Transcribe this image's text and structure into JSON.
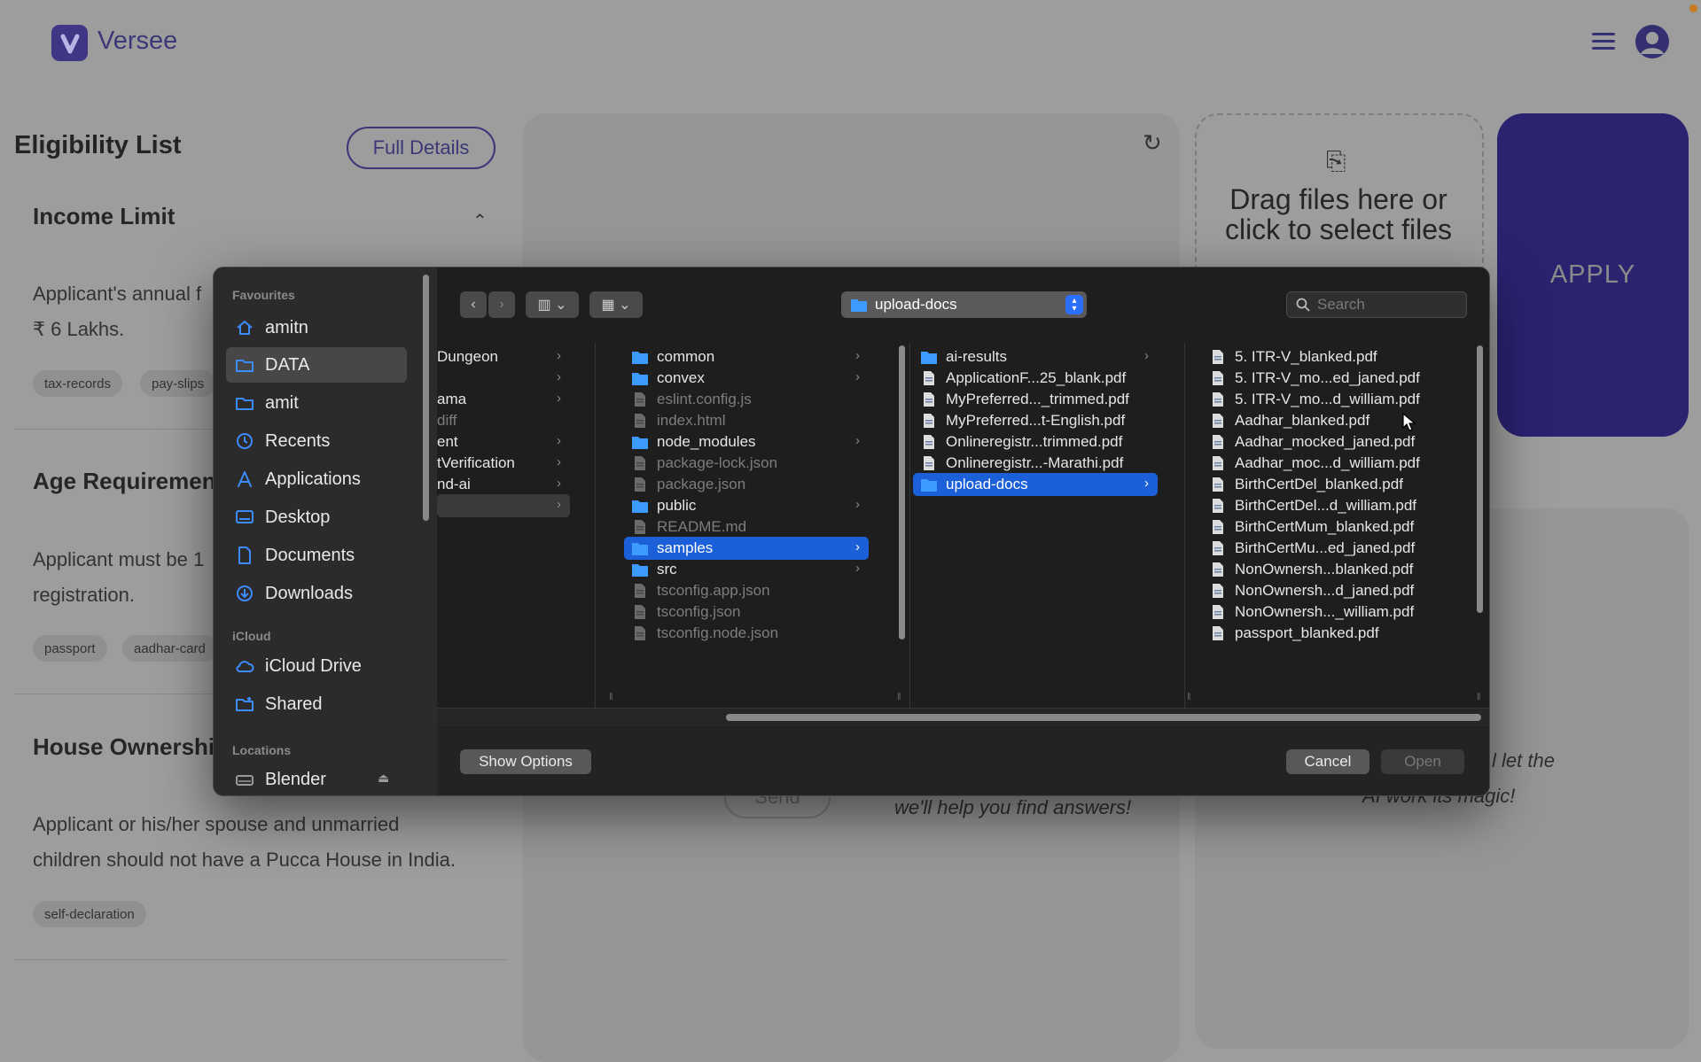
{
  "app": {
    "name": "Versee"
  },
  "eligibility": {
    "title": "Eligibility List",
    "full_details_label": "Full Details",
    "sections": [
      {
        "title": "Income Limit",
        "text_lines": [
          "Applicant's annual f",
          "₹ 6 Lakhs."
        ],
        "tags": [
          "tax-records",
          "pay-slips"
        ]
      },
      {
        "title": "Age Requiremen",
        "text_lines": [
          "Applicant must be 1",
          "registration."
        ],
        "tags": [
          "passport",
          "aadhar-card"
        ]
      },
      {
        "title": "House Ownershi",
        "text_lines": [
          "Applicant or his/her spouse and unmarried",
          "children should not have a Pucca House in India."
        ],
        "tags": [
          "self-declaration"
        ]
      }
    ]
  },
  "upload": {
    "drop_text": "Drag files here or click to select files"
  },
  "apply_label": "APPLY",
  "chat": {
    "send_label": "Send",
    "hint": "we'll help you find answers!"
  },
  "ai_hint": {
    "line1": "l let the",
    "line2": "AI work its magic!"
  },
  "dialog": {
    "location": "upload-docs",
    "search_placeholder": "Search",
    "sidebar": {
      "favourites_heading": "Favourites",
      "favourites": [
        {
          "label": "amitn",
          "icon": "home-icon"
        },
        {
          "label": "DATA",
          "icon": "folder-icon",
          "selected": true
        },
        {
          "label": "amit",
          "icon": "folder-icon"
        },
        {
          "label": "Recents",
          "icon": "clock-icon"
        },
        {
          "label": "Applications",
          "icon": "applications-icon"
        },
        {
          "label": "Desktop",
          "icon": "desktop-icon"
        },
        {
          "label": "Documents",
          "icon": "document-icon"
        },
        {
          "label": "Downloads",
          "icon": "download-icon"
        }
      ],
      "icloud_heading": "iCloud",
      "icloud": [
        {
          "label": "iCloud Drive",
          "icon": "cloud-icon"
        },
        {
          "label": "Shared",
          "icon": "shared-folder-icon"
        }
      ],
      "locations_heading": "Locations",
      "locations": [
        {
          "label": "Blender",
          "icon": "disk-icon"
        }
      ]
    },
    "columns": [
      {
        "items": [
          {
            "name": "Dungeon",
            "folder": true
          },
          {
            "name": "",
            "folder": true
          },
          {
            "name": "ama",
            "folder": true
          },
          {
            "name": "diff",
            "dim": true
          },
          {
            "name": "ent",
            "folder": true
          },
          {
            "name": "tVerification",
            "folder": true
          },
          {
            "name": "nd-ai",
            "folder": true
          },
          {
            "name": "",
            "folder": true,
            "highlight": true
          }
        ]
      },
      {
        "items": [
          {
            "name": "common",
            "type": "folder"
          },
          {
            "name": "convex",
            "type": "folder"
          },
          {
            "name": "eslint.config.js",
            "type": "file",
            "dim": true
          },
          {
            "name": "index.html",
            "type": "file",
            "dim": true
          },
          {
            "name": "node_modules",
            "type": "folder"
          },
          {
            "name": "package-lock.json",
            "type": "file",
            "dim": true
          },
          {
            "name": "package.json",
            "type": "file",
            "dim": true
          },
          {
            "name": "public",
            "type": "folder"
          },
          {
            "name": "README.md",
            "type": "file",
            "dim": true
          },
          {
            "name": "samples",
            "type": "folder",
            "selected": true
          },
          {
            "name": "src",
            "type": "folder"
          },
          {
            "name": "tsconfig.app.json",
            "type": "file",
            "dim": true
          },
          {
            "name": "tsconfig.json",
            "type": "file",
            "dim": true
          },
          {
            "name": "tsconfig.node.json",
            "type": "file",
            "dim": true
          }
        ]
      },
      {
        "items": [
          {
            "name": "ai-results",
            "type": "folder"
          },
          {
            "name": "ApplicationF...25_blank.pdf",
            "type": "pdf"
          },
          {
            "name": "MyPreferred..._trimmed.pdf",
            "type": "pdf"
          },
          {
            "name": "MyPreferred...t-English.pdf",
            "type": "pdf"
          },
          {
            "name": "Onlineregistr...trimmed.pdf",
            "type": "pdf"
          },
          {
            "name": "Onlineregistr...-Marathi.pdf",
            "type": "pdf"
          },
          {
            "name": "upload-docs",
            "type": "folder",
            "selected": true
          }
        ]
      },
      {
        "items": [
          {
            "name": "5. ITR-V_blanked.pdf",
            "type": "pdf"
          },
          {
            "name": "5. ITR-V_mo...ed_janed.pdf",
            "type": "pdf"
          },
          {
            "name": "5. ITR-V_mo...d_william.pdf",
            "type": "pdf"
          },
          {
            "name": "Aadhar_blanked.pdf",
            "type": "pdf"
          },
          {
            "name": "Aadhar_mocked_janed.pdf",
            "type": "pdf"
          },
          {
            "name": "Aadhar_moc...d_william.pdf",
            "type": "pdf"
          },
          {
            "name": "BirthCertDel_blanked.pdf",
            "type": "pdf"
          },
          {
            "name": "BirthCertDel...d_william.pdf",
            "type": "pdf"
          },
          {
            "name": "BirthCertMum_blanked.pdf",
            "type": "pdf"
          },
          {
            "name": "BirthCertMu...ed_janed.pdf",
            "type": "pdf"
          },
          {
            "name": "NonOwnersh...blanked.pdf",
            "type": "pdf"
          },
          {
            "name": "NonOwnersh...d_janed.pdf",
            "type": "pdf"
          },
          {
            "name": "NonOwnersh..._william.pdf",
            "type": "pdf"
          },
          {
            "name": "passport_blanked.pdf",
            "type": "pdf"
          }
        ]
      }
    ],
    "show_options_label": "Show Options",
    "cancel_label": "Cancel",
    "open_label": "Open"
  }
}
